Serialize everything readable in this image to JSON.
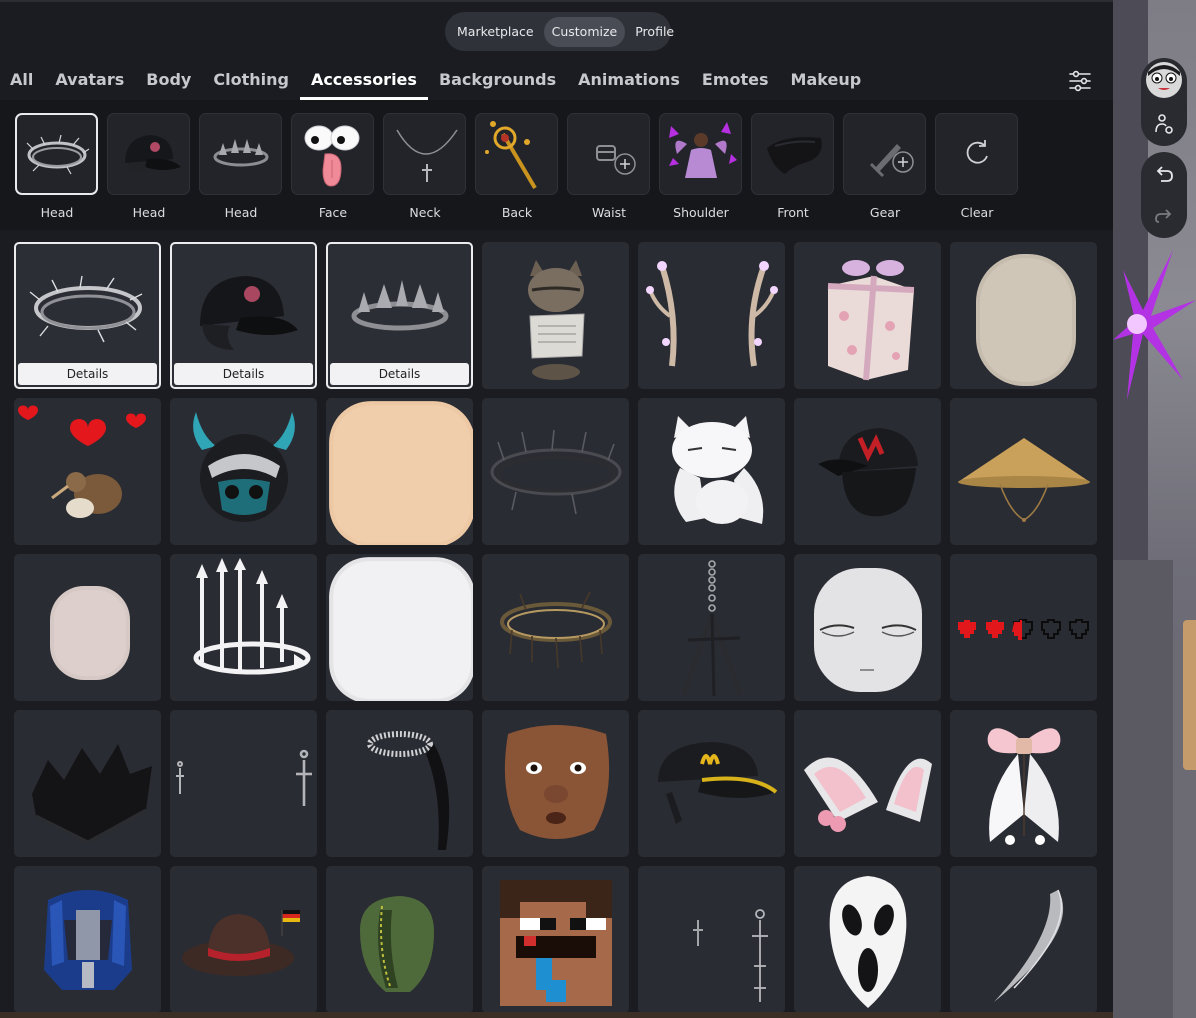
{
  "top_switch": {
    "items": [
      "Marketplace",
      "Customize",
      "Profile"
    ],
    "active": 1
  },
  "categories": {
    "items": [
      "All",
      "Avatars",
      "Body",
      "Clothing",
      "Accessories",
      "Backgrounds",
      "Animations",
      "Emotes",
      "Makeup"
    ],
    "active": 4
  },
  "subcategories": [
    {
      "label": "Head",
      "icon": "thorn-crown-icon"
    },
    {
      "label": "Head",
      "icon": "black-cap-icon"
    },
    {
      "label": "Head",
      "icon": "silver-tiara-icon"
    },
    {
      "label": "Face",
      "icon": "googly-eyes-tongue-icon"
    },
    {
      "label": "Neck",
      "icon": "cross-necklace-icon"
    },
    {
      "label": "Back",
      "icon": "golden-staff-icon"
    },
    {
      "label": "Waist",
      "icon": "waist-add-icon"
    },
    {
      "label": "Shoulder",
      "icon": "fairy-shoulder-icon"
    },
    {
      "label": "Front",
      "icon": "black-hair-front-icon"
    },
    {
      "label": "Gear",
      "icon": "gear-sword-add-icon"
    },
    {
      "label": "Clear",
      "icon": "clear-reset-icon"
    }
  ],
  "grid": {
    "details_label": "Details",
    "items": [
      "thorn-crown-icon",
      "black-cap-hair-icon",
      "silver-spike-tiara-icon",
      "cat-newspaper-icon",
      "glowing-antlers-icon",
      "sakura-gift-box-icon",
      "beige-head-icon",
      "kiwi-hearts-icon",
      "horned-helmet-icon",
      "peach-head-icon",
      "barbed-wire-halo-icon",
      "white-cat-icon",
      "red-black-cap-icon",
      "straw-hat-icon",
      "pale-head-icon",
      "silver-crown-icon",
      "white-head-icon",
      "gold-thorn-crown-icon",
      "chain-tripod-icon",
      "sleepy-face-head-icon",
      "pixel-hearts-icon",
      "black-crown-icon",
      "cross-earrings-icon",
      "halo-hair-icon",
      "brown-face-icon",
      "mcdonalds-cap-icon",
      "pink-cat-ears-icon",
      "pink-bow-icon",
      "robot-helmet-icon",
      "german-fedora-icon",
      "green-hood-icon",
      "pixel-head-icon",
      "chain-earrings-icon",
      "ghostface-mask-icon",
      "silver-scythe-icon"
    ]
  }
}
